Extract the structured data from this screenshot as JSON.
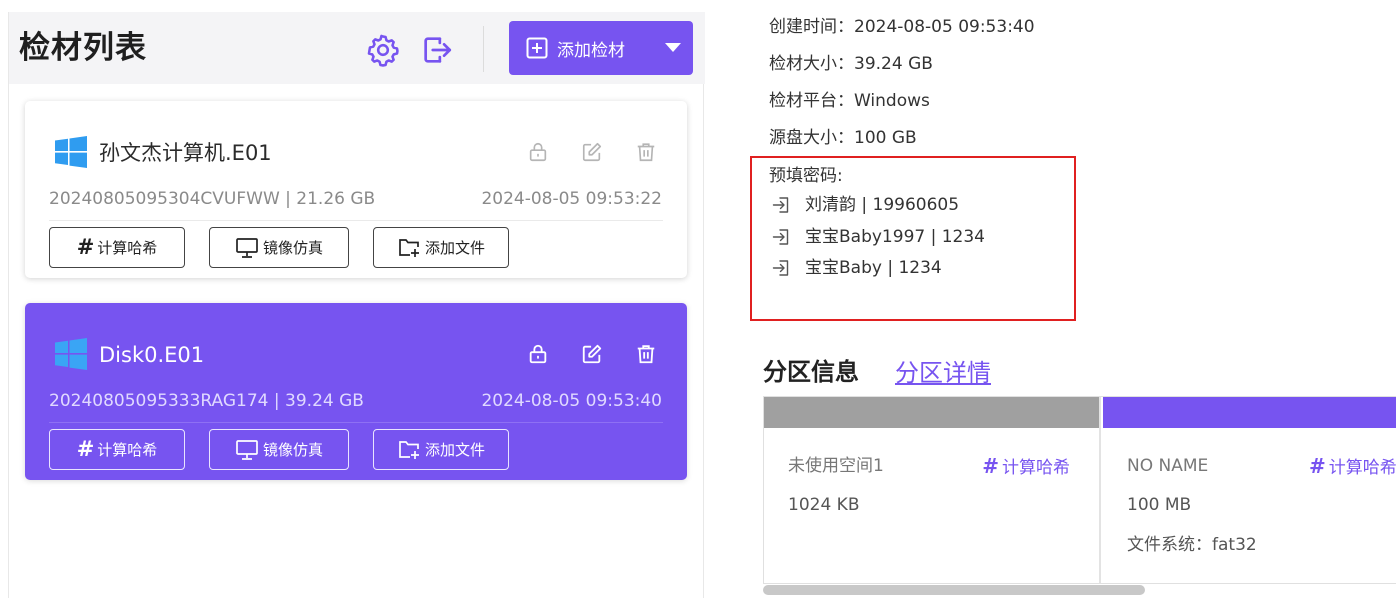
{
  "left": {
    "title": "检材列表",
    "add_button_label": "添加检材"
  },
  "evidence": [
    {
      "name": "孙文杰计算机.E01",
      "meta": "20240805095304CVUFWW | 21.26 GB",
      "time": "2024-08-05 09:53:22",
      "selected": false,
      "buttons": {
        "hash": "计算哈希",
        "mirror": "镜像仿真",
        "add_file": "添加文件"
      }
    },
    {
      "name": "Disk0.E01",
      "meta": "20240805095333RAG174 | 39.24 GB",
      "time": "2024-08-05 09:53:40",
      "selected": true,
      "buttons": {
        "hash": "计算哈希",
        "mirror": "镜像仿真",
        "add_file": "添加文件"
      }
    }
  ],
  "details": {
    "created": "创建时间：2024-08-05 09:53:40",
    "size": "检材大小：39.24 GB",
    "platform": "检材平台：Windows",
    "source_size": "源盘大小：100 GB",
    "password_label": "预填密码:",
    "passwords": [
      "刘清韵 | 19960605",
      "宝宝Baby1997 | 1234",
      "宝宝Baby | 1234"
    ]
  },
  "partitions": {
    "title": "分区信息",
    "detail_link": "分区详情",
    "items": [
      {
        "name": "未使用空间1",
        "size": "1024 KB",
        "fs": "",
        "hash_label": "计算哈希"
      },
      {
        "name": "NO NAME",
        "size": "100 MB",
        "fs": "文件系统：fat32",
        "hash_label": "计算哈希"
      }
    ]
  },
  "colors": {
    "accent": "#7754f0",
    "highlight_border": "#e02020",
    "windows_blue": "#2f9cf0"
  },
  "icons": {
    "settings": "gear-icon",
    "logout": "logout-icon",
    "add": "plus-square-icon",
    "os": "windows-icon",
    "lock": "lock-icon",
    "edit": "edit-icon",
    "delete": "trash-icon",
    "hash": "hash-icon",
    "mirror": "monitor-icon",
    "add_file": "folder-plus-icon",
    "password": "login-arrow-icon"
  }
}
